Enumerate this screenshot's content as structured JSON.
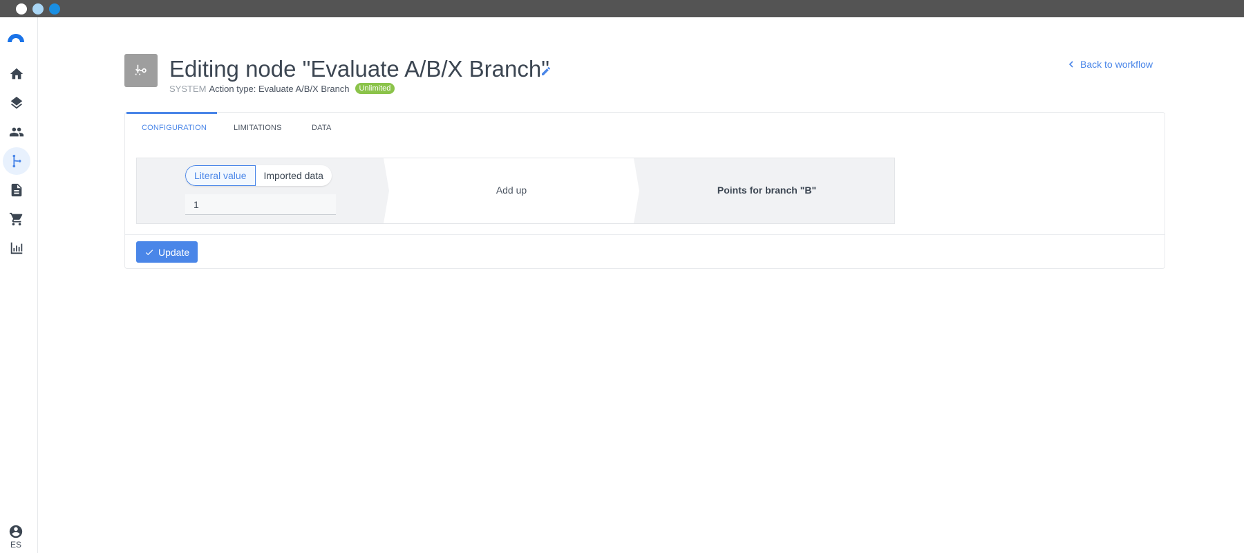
{
  "header": {
    "title": "Editing node \"Evaluate A/B/X Branch\"",
    "system_label": "SYSTEM",
    "action_type": "Action type: Evaluate A/B/X Branch",
    "badge": "Unlimited",
    "back_link": "Back to workflow"
  },
  "sidebar": {
    "items": [
      {
        "icon": "home-icon"
      },
      {
        "icon": "layers-icon"
      },
      {
        "icon": "people-icon"
      },
      {
        "icon": "workflow-branch-icon",
        "active": true
      },
      {
        "icon": "document-icon"
      },
      {
        "icon": "cart-icon"
      },
      {
        "icon": "chart-icon"
      }
    ],
    "user_label": "ES"
  },
  "tabs": [
    {
      "label": "CONFIGURATION",
      "active": true
    },
    {
      "label": "LIMITATIONS"
    },
    {
      "label": "DATA"
    }
  ],
  "config": {
    "source_options": [
      "Literal value",
      "Imported data"
    ],
    "selected_source": "Literal value",
    "value": "1",
    "operation": "Add up",
    "target": "Points for branch \"B\""
  },
  "footer": {
    "update_label": "Update"
  },
  "colors": {
    "accent": "#4a86e8",
    "badge": "#8bc34a",
    "titlebar": "#545454"
  }
}
